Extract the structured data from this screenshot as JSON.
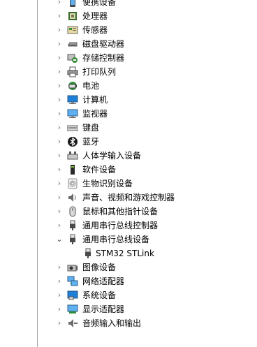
{
  "device_manager": {
    "categories": [
      {
        "label": "便携设备",
        "icon": "portable-device-icon",
        "expanded": false
      },
      {
        "label": "处理器",
        "icon": "processor-icon",
        "expanded": false
      },
      {
        "label": "传感器",
        "icon": "sensor-icon",
        "expanded": false
      },
      {
        "label": "磁盘驱动器",
        "icon": "disk-drive-icon",
        "expanded": false
      },
      {
        "label": "存储控制器",
        "icon": "storage-controller-icon",
        "expanded": false
      },
      {
        "label": "打印队列",
        "icon": "printer-icon",
        "expanded": false
      },
      {
        "label": "电池",
        "icon": "battery-icon",
        "expanded": false
      },
      {
        "label": "计算机",
        "icon": "computer-icon",
        "expanded": false
      },
      {
        "label": "监视器",
        "icon": "monitor-icon",
        "expanded": false
      },
      {
        "label": "键盘",
        "icon": "keyboard-icon",
        "expanded": false
      },
      {
        "label": "蓝牙",
        "icon": "bluetooth-icon",
        "expanded": false
      },
      {
        "label": "人体学输入设备",
        "icon": "hid-icon",
        "expanded": false
      },
      {
        "label": "软件设备",
        "icon": "software-device-icon",
        "expanded": false
      },
      {
        "label": "生物识别设备",
        "icon": "fingerprint-icon",
        "expanded": false
      },
      {
        "label": "声音、视频和游戏控制器",
        "icon": "speaker-icon",
        "expanded": false
      },
      {
        "label": "鼠标和其他指针设备",
        "icon": "mouse-icon",
        "expanded": false
      },
      {
        "label": "通用串行总线控制器",
        "icon": "usb-icon",
        "expanded": false
      },
      {
        "label": "通用串行总线设备",
        "icon": "usb-icon",
        "expanded": true,
        "children": [
          {
            "label": "STM32 STLink",
            "icon": "usb-icon"
          }
        ]
      },
      {
        "label": "图像设备",
        "icon": "camera-icon",
        "expanded": false
      },
      {
        "label": "网络适配器",
        "icon": "network-adapter-icon",
        "expanded": false
      },
      {
        "label": "系统设备",
        "icon": "system-device-icon",
        "expanded": false
      },
      {
        "label": "显示适配器",
        "icon": "display-adapter-icon",
        "expanded": false
      },
      {
        "label": "音频输入和输出",
        "icon": "audio-io-icon",
        "expanded": false
      }
    ],
    "glyphs": {
      "collapsed": "›",
      "expanded": "⌄"
    },
    "colors": {
      "background": "#ffffff",
      "chevron": "#707070",
      "icon_blue": "#1e7fd6",
      "icon_gray": "#6b6b6b"
    }
  }
}
